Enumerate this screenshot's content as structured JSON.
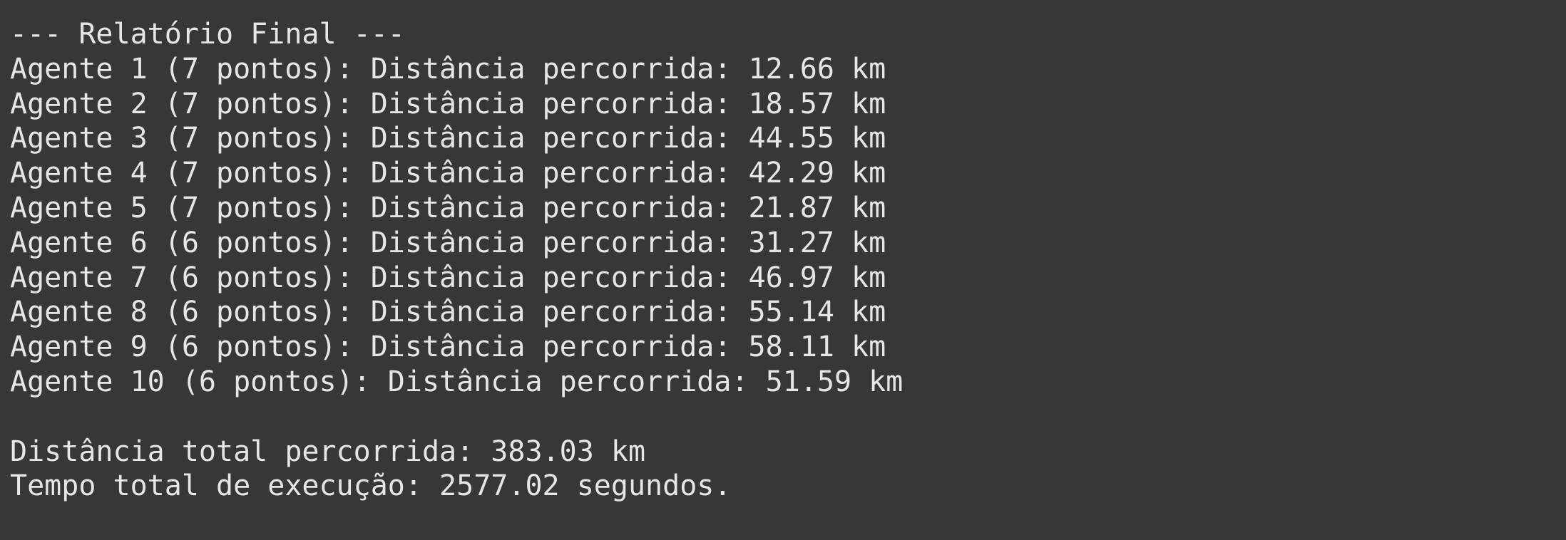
{
  "terminal": {
    "header": "--- Relatório Final ---",
    "agents": [
      "Agente 1 (7 pontos): Distância percorrida: 12.66 km",
      "Agente 2 (7 pontos): Distância percorrida: 18.57 km",
      "Agente 3 (7 pontos): Distância percorrida: 44.55 km",
      "Agente 4 (7 pontos): Distância percorrida: 42.29 km",
      "Agente 5 (7 pontos): Distância percorrida: 21.87 km",
      "Agente 6 (6 pontos): Distância percorrida: 31.27 km",
      "Agente 7 (6 pontos): Distância percorrida: 46.97 km",
      "Agente 8 (6 pontos): Distância percorrida: 55.14 km",
      "Agente 9 (6 pontos): Distância percorrida: 58.11 km",
      "Agente 10 (6 pontos): Distância percorrida: 51.59 km"
    ],
    "total_distance": "Distância total percorrida: 383.03 km",
    "total_time": "Tempo total de execução: 2577.02 segundos.",
    "colors": {
      "background": "#373737",
      "text": "#e6e6e6"
    }
  }
}
